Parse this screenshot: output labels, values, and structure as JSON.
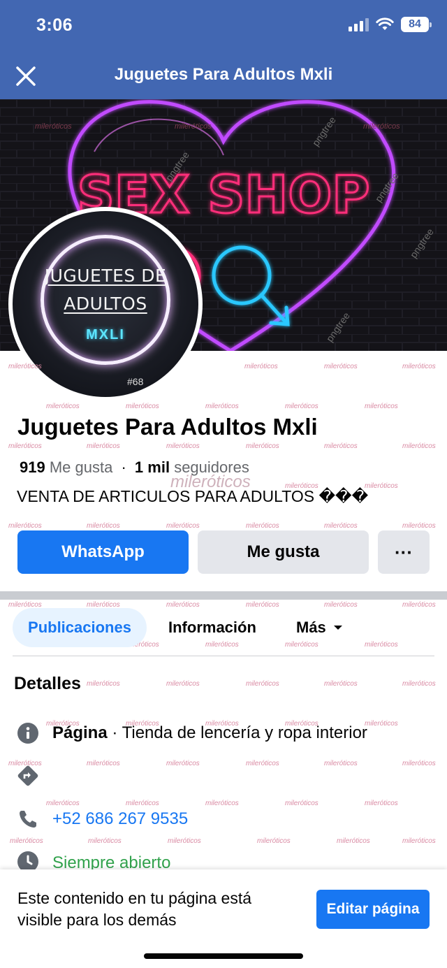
{
  "status_bar": {
    "time": "3:06",
    "battery": "84"
  },
  "header": {
    "title": "Juguetes Para Adultos Mxli"
  },
  "cover": {
    "sign_text": "SEX SHOP",
    "watermark": "pngtree"
  },
  "avatar": {
    "line1": "JUGUETES DE",
    "line2": "ADULTOS",
    "line3": "MXLI",
    "tag": "#68"
  },
  "watermark": {
    "text": "mileróticos"
  },
  "profile": {
    "name": "Juguetes Para Adultos Mxli",
    "likes_count": "919",
    "likes_label": "Me gusta",
    "separator": "·",
    "followers_count": "1 mil",
    "followers_label": "seguidores",
    "bio": "VENTA DE ARTICULOS PARA ADULTOS ���"
  },
  "actions": {
    "whatsapp": "WhatsApp",
    "like": "Me gusta",
    "more": "···"
  },
  "tabs": {
    "posts": "Publicaciones",
    "info": "Información",
    "more": "Más"
  },
  "details": {
    "title": "Detalles",
    "page_label": "Página",
    "page_category": "· Tienda de lencería y ropa interior",
    "phone": "+52 686 267 9535",
    "hours": "Siempre abierto"
  },
  "bottom_banner": {
    "text": "Este contenido en tu página está visible para los demás",
    "edit_button": "Editar página"
  },
  "colors": {
    "header_bg": "#4267b2",
    "primary": "#1877f2",
    "open_green": "#31a24c"
  }
}
